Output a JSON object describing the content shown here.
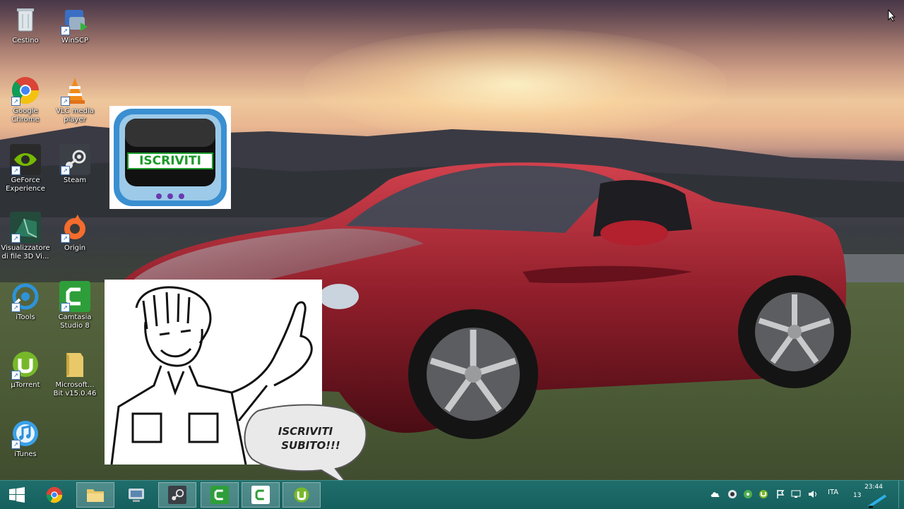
{
  "desktop": {
    "icons": [
      {
        "label": "Cestino"
      },
      {
        "label": "WinSCP"
      },
      {
        "label": "Google\nChrome"
      },
      {
        "label": "VLC media\nplayer"
      },
      {
        "label": "GeForce\nExperience"
      },
      {
        "label": "Steam"
      },
      {
        "label": "Visualizzatore\ndi file 3D Vi..."
      },
      {
        "label": "Origin"
      },
      {
        "label": "iTools"
      },
      {
        "label": "Camtasia\nStudio 8"
      },
      {
        "label": "µTorrent"
      },
      {
        "label": "Microsoft...\nBit v15.0.46"
      },
      {
        "label": "iTunes"
      }
    ]
  },
  "overlays": {
    "tv_text": "ISCRIVITI",
    "bubble_line1": "ISCRIVITI",
    "bubble_line2": "SUBITO!!!"
  },
  "taskbar": {
    "language": "ITA",
    "time": "23:44",
    "date": "13",
    "pinned": [
      "start-button",
      "chrome",
      "file-explorer",
      "control-panel",
      "steam",
      "camtasia-1",
      "camtasia-2",
      "utorrent"
    ]
  },
  "colors": {
    "taskbar": "#15605f",
    "chrome_red": "#db4437",
    "steam_dark": "#1b2838",
    "camtasia_green": "#2e9e3a",
    "utorrent_green": "#77b82a"
  }
}
